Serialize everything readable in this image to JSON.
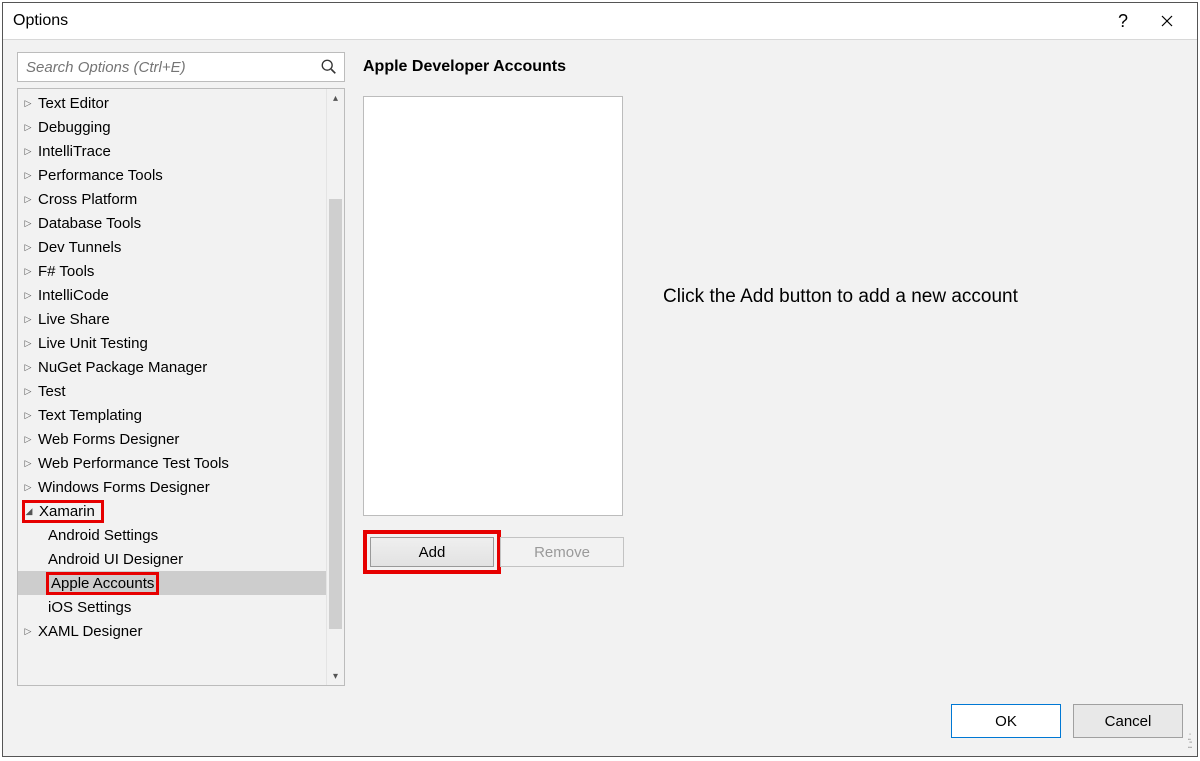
{
  "window": {
    "title": "Options"
  },
  "search": {
    "placeholder": "Search Options (Ctrl+E)"
  },
  "tree": {
    "items": [
      {
        "label": "Text Editor",
        "expanded": false,
        "child": false
      },
      {
        "label": "Debugging",
        "expanded": false,
        "child": false
      },
      {
        "label": "IntelliTrace",
        "expanded": false,
        "child": false
      },
      {
        "label": "Performance Tools",
        "expanded": false,
        "child": false
      },
      {
        "label": "Cross Platform",
        "expanded": false,
        "child": false
      },
      {
        "label": "Database Tools",
        "expanded": false,
        "child": false
      },
      {
        "label": "Dev Tunnels",
        "expanded": false,
        "child": false
      },
      {
        "label": "F# Tools",
        "expanded": false,
        "child": false
      },
      {
        "label": "IntelliCode",
        "expanded": false,
        "child": false
      },
      {
        "label": "Live Share",
        "expanded": false,
        "child": false
      },
      {
        "label": "Live Unit Testing",
        "expanded": false,
        "child": false
      },
      {
        "label": "NuGet Package Manager",
        "expanded": false,
        "child": false
      },
      {
        "label": "Test",
        "expanded": false,
        "child": false
      },
      {
        "label": "Text Templating",
        "expanded": false,
        "child": false
      },
      {
        "label": "Web Forms Designer",
        "expanded": false,
        "child": false
      },
      {
        "label": "Web Performance Test Tools",
        "expanded": false,
        "child": false
      },
      {
        "label": "Windows Forms Designer",
        "expanded": false,
        "child": false
      },
      {
        "label": "Xamarin",
        "expanded": true,
        "child": false,
        "highlight": true
      },
      {
        "label": "Android Settings",
        "expanded": false,
        "child": true
      },
      {
        "label": "Android UI Designer",
        "expanded": false,
        "child": true
      },
      {
        "label": "Apple Accounts",
        "expanded": false,
        "child": true,
        "selected": true,
        "highlight": true
      },
      {
        "label": "iOS Settings",
        "expanded": false,
        "child": true
      },
      {
        "label": "XAML Designer",
        "expanded": false,
        "child": false
      }
    ]
  },
  "panel": {
    "heading": "Apple Developer Accounts",
    "hint": "Click the Add button to add a new account",
    "add_label": "Add",
    "remove_label": "Remove"
  },
  "dialog": {
    "ok": "OK",
    "cancel": "Cancel"
  }
}
